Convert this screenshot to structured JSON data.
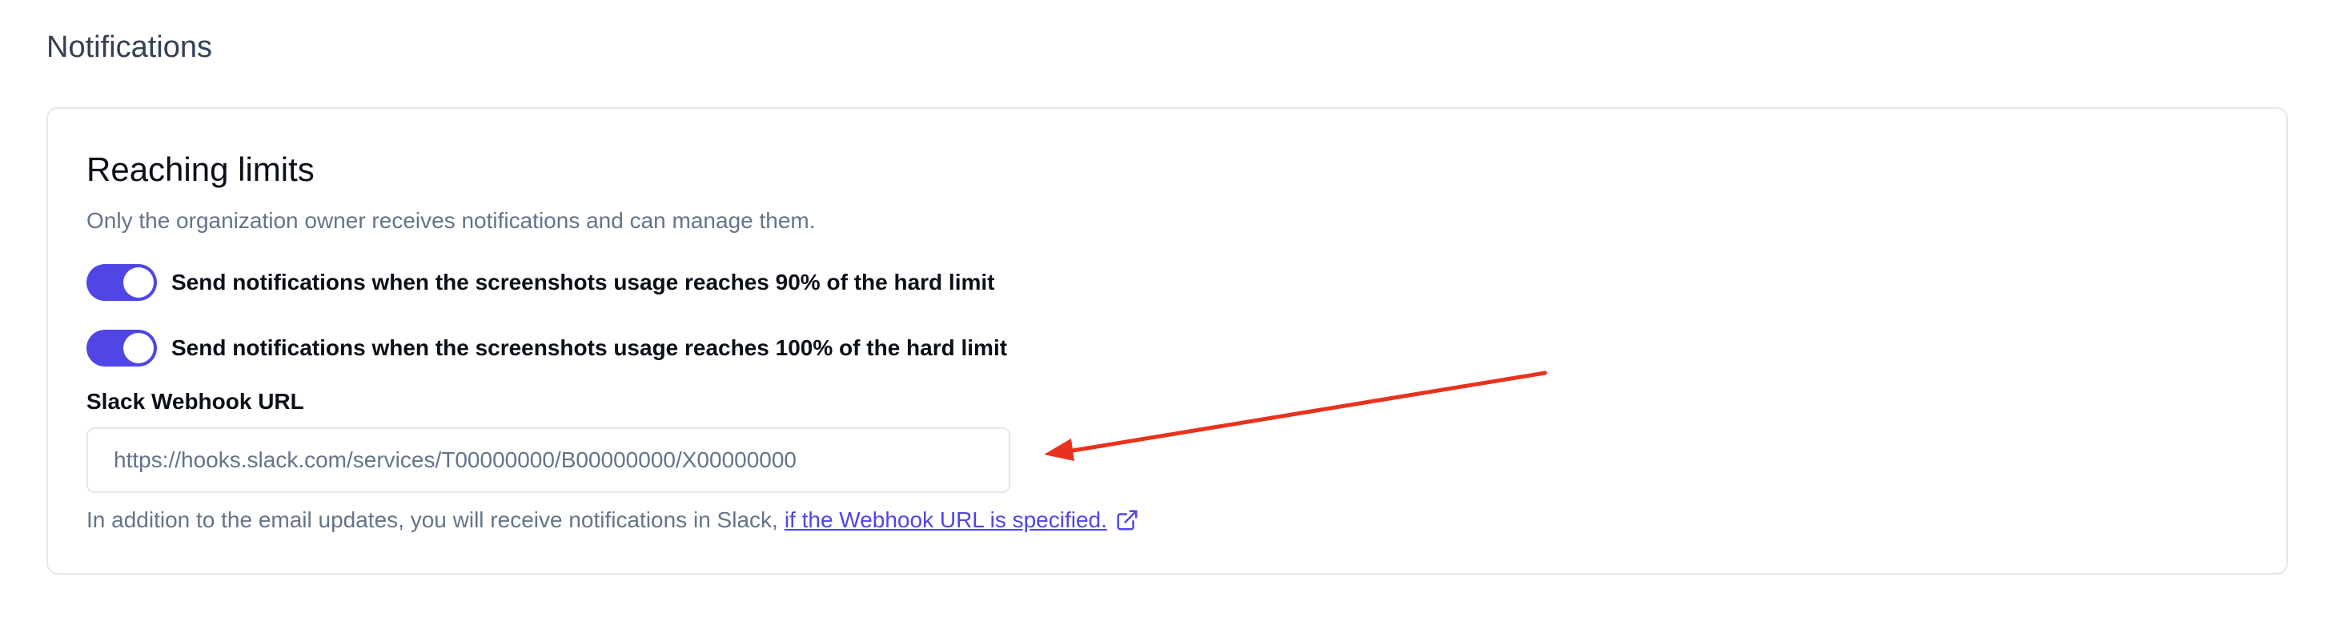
{
  "section": {
    "title": "Notifications"
  },
  "card": {
    "title": "Reaching limits",
    "description": "Only the organization owner receives notifications and can manage them.",
    "toggles": [
      {
        "label": "Send notifications when the screenshots usage reaches 90% of the hard limit",
        "checked": true
      },
      {
        "label": "Send notifications when the screenshots usage reaches 100% of the hard limit",
        "checked": true
      }
    ],
    "webhook": {
      "label": "Slack Webhook URL",
      "placeholder": "https://hooks.slack.com/services/T00000000/B00000000/X00000000",
      "value": ""
    },
    "help": {
      "text": "In addition to the email updates, you will receive notifications in Slack,",
      "link_text": "if the Webhook URL is specified."
    }
  },
  "colors": {
    "accent": "#4f46e5",
    "annotation_arrow": "#e8321e",
    "muted_text": "#64748b",
    "border": "#e5e7eb"
  },
  "icons": {
    "external_link": "external-link-icon"
  }
}
